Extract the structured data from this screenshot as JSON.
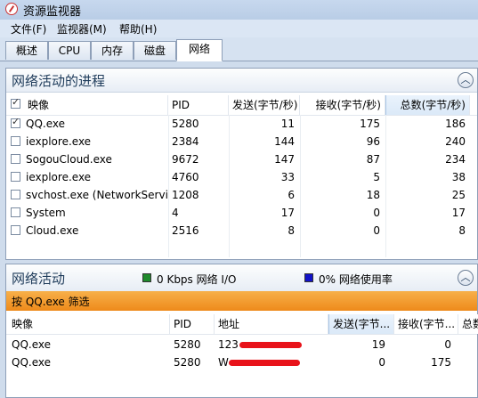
{
  "window": {
    "title": "资源监视器"
  },
  "menu": [
    "文件(F)",
    "监视器(M)",
    "帮助(H)"
  ],
  "tabs": [
    "概述",
    "CPU",
    "内存",
    "磁盘",
    "网络"
  ],
  "active_tab": "网络",
  "processes": {
    "title": "网络活动的进程",
    "columns": [
      "映像",
      "PID",
      "发送(字节/秒)",
      "接收(字节/秒)",
      "总数(字节/秒)"
    ],
    "rows": [
      {
        "name": "QQ.exe",
        "pid": "5280",
        "send": "11",
        "recv": "175",
        "total": "186",
        "checked": true
      },
      {
        "name": "iexplore.exe",
        "pid": "2384",
        "send": "144",
        "recv": "96",
        "total": "240",
        "checked": false
      },
      {
        "name": "SogouCloud.exe",
        "pid": "9672",
        "send": "147",
        "recv": "87",
        "total": "234",
        "checked": false
      },
      {
        "name": "iexplore.exe",
        "pid": "4760",
        "send": "33",
        "recv": "5",
        "total": "38",
        "checked": false
      },
      {
        "name": "svchost.exe (NetworkService)",
        "pid": "1208",
        "send": "6",
        "recv": "18",
        "total": "25",
        "checked": false
      },
      {
        "name": "System",
        "pid": "4",
        "send": "17",
        "recv": "0",
        "total": "17",
        "checked": false
      },
      {
        "name": "Cloud.exe",
        "pid": "2516",
        "send": "8",
        "recv": "0",
        "total": "8",
        "checked": false
      }
    ]
  },
  "activity": {
    "title": "网络活动",
    "io_label": "0 Kbps 网络 I/O",
    "usage_label": "0% 网络使用率",
    "io_color": "#1f8a2c",
    "usage_color": "#1212c8",
    "filter_label": "按 QQ.exe 筛选",
    "columns": [
      "映像",
      "PID",
      "地址",
      "发送(字节...",
      "接收(字节...",
      "总数"
    ],
    "rows": [
      {
        "name": "QQ.exe",
        "pid": "5280",
        "address": "123",
        "send": "19",
        "recv": "0"
      },
      {
        "name": "QQ.exe",
        "pid": "5280",
        "address": "W",
        "send": "0",
        "recv": "175"
      }
    ]
  }
}
